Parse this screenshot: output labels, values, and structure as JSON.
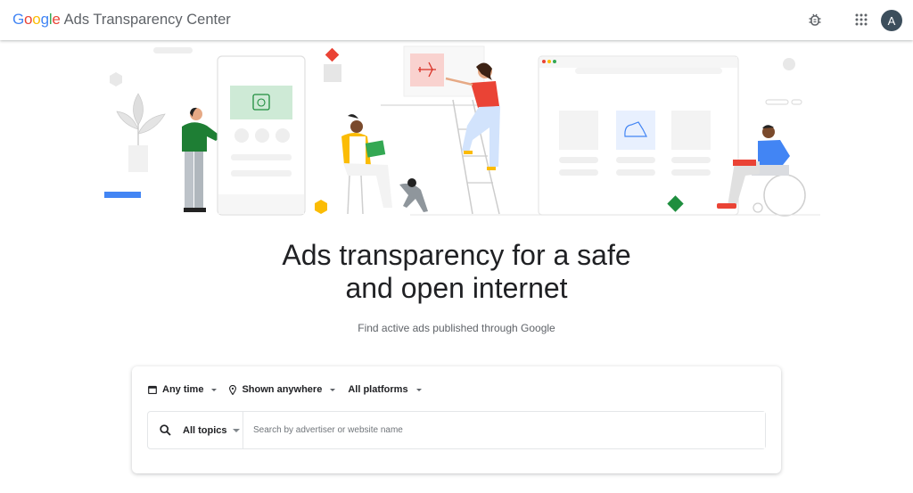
{
  "header": {
    "brand_letters": [
      {
        "ch": "G",
        "color": "#4285F4"
      },
      {
        "ch": "o",
        "color": "#EA4335"
      },
      {
        "ch": "o",
        "color": "#FBBC05"
      },
      {
        "ch": "g",
        "color": "#4285F4"
      },
      {
        "ch": "l",
        "color": "#34A853"
      },
      {
        "ch": "e",
        "color": "#EA4335"
      }
    ],
    "title": "Ads Transparency Center",
    "icons": [
      "bug-report-icon",
      "apps-grid-icon"
    ],
    "avatar_initial": "A"
  },
  "hero": {
    "headline_line1": "Ads transparency for a safe",
    "headline_line2": "and open internet",
    "subtitle": "Find active ads published through Google"
  },
  "search_card": {
    "filters": [
      {
        "label": "Any time",
        "icon": "calendar-icon"
      },
      {
        "label": "Shown anywhere",
        "icon": "location-pin-icon"
      },
      {
        "label": "All platforms",
        "icon": null
      }
    ],
    "topics_label": "All topics",
    "search_placeholder": "Search by advertiser or website name",
    "search_value": ""
  },
  "colors": {
    "accent_blue": "#4285F4",
    "red": "#EA4335",
    "yellow": "#FBBC05",
    "green": "#1E8E3E",
    "avatar_bg": "#3C4E5C"
  }
}
